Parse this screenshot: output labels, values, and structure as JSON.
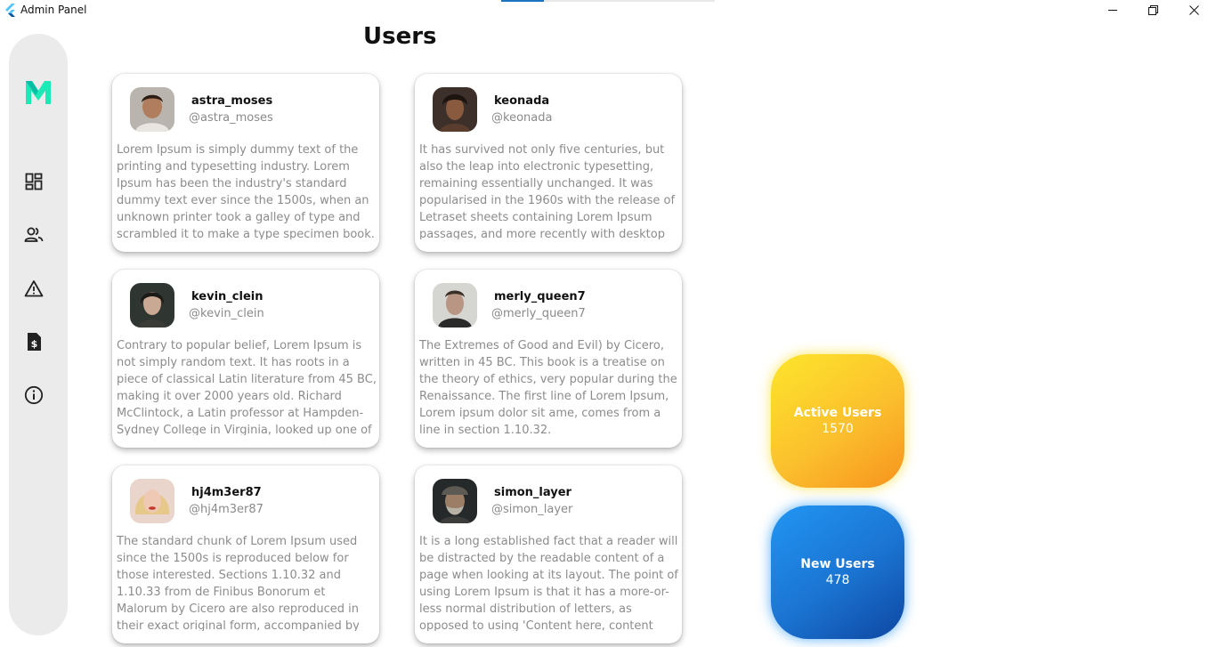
{
  "window": {
    "title": "Admin Panel",
    "progress_fraction": 0.2,
    "controls": [
      "minimize-icon",
      "restore-icon",
      "close-icon"
    ]
  },
  "sidebar": {
    "logo": "m-logo-icon",
    "items": [
      {
        "icon": "dashboard-icon"
      },
      {
        "icon": "users-icon"
      },
      {
        "icon": "warning-icon"
      },
      {
        "icon": "invoice-icon"
      },
      {
        "icon": "info-icon"
      }
    ]
  },
  "page": {
    "title": "Users"
  },
  "users": [
    {
      "name": "astra_moses",
      "handle": "@astra_moses",
      "bio": "Lorem Ipsum is simply dummy text of the printing and typesetting industry. Lorem Ipsum has been the industry's standard dummy text ever since the 1500s, when an unknown printer took a galley of type and scrambled it to make a type specimen book."
    },
    {
      "name": "keonada",
      "handle": "@keonada",
      "bio": "It has survived not only five centuries, but also the leap into electronic typesetting, remaining essentially unchanged. It was popularised in the 1960s with the release of Letraset sheets containing Lorem Ipsum passages, and more recently with desktop publishing software like"
    },
    {
      "name": "kevin_clein",
      "handle": "@kevin_clein",
      "bio": "Contrary to popular belief, Lorem Ipsum is not simply random text. It has roots in a piece of classical Latin literature from 45 BC, making it over 2000 years old. Richard McClintock, a Latin professor at Hampden-Sydney College in Virginia, looked up one of the more obscure"
    },
    {
      "name": "merly_queen7",
      "handle": "@merly_queen7",
      "bio": "The Extremes of Good and Evil) by Cicero, written in 45 BC. This book is a treatise on the theory of ethics, very popular during the Renaissance. The first line of Lorem Ipsum, Lorem ipsum dolor sit ame, comes from a line in section 1.10.32."
    },
    {
      "name": "hj4m3er87",
      "handle": "@hj4m3er87",
      "bio": "The standard chunk of Lorem Ipsum used since the 1500s is reproduced below for those interested. Sections 1.10.32 and 1.10.33 from de Finibus Bonorum et Malorum by Cicero are also reproduced in their exact original form, accompanied by English versions from the"
    },
    {
      "name": "simon_layer",
      "handle": "@simon_layer",
      "bio": "It is a long established fact that a reader will be distracted by the readable content of a page when looking at its layout. The point of using Lorem Ipsum is that it has a more-or-less normal distribution of letters, as opposed to using 'Content here, content here', making"
    }
  ],
  "stats": {
    "active": {
      "label": "Active Users",
      "value": "1570",
      "colors": [
        "#fde52b",
        "#f7931e"
      ]
    },
    "new": {
      "label": "New Users",
      "value": "478",
      "colors": [
        "#2196f3",
        "#0d47a1"
      ]
    }
  },
  "colors": {
    "sidebar_bg": "#ebebeb",
    "logo": "#1de9b6",
    "muted_text": "#8c8c8c"
  }
}
